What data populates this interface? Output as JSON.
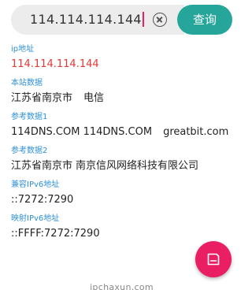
{
  "search": {
    "value": "114.114.114.144",
    "button_label": "查询"
  },
  "results": [
    {
      "label": "ip地址",
      "value": "114.114.114.144",
      "highlight": true
    },
    {
      "label": "本站数据",
      "parts": [
        "江苏省南京市",
        "电信"
      ]
    },
    {
      "label": "参考数据1",
      "parts": [
        "114DNS.COM 114DNS.COM",
        "greatbit.com"
      ]
    },
    {
      "label": "参考数据2",
      "parts": [
        "江苏省南京市",
        "南京信风网络科技有限公司"
      ]
    },
    {
      "label": "兼容IPv6地址",
      "value": "::7272:7290"
    },
    {
      "label": "映射IPv6地址",
      "value": "::FFFF:7272:7290"
    }
  ],
  "fab": {
    "icon": "save-icon"
  },
  "footer": {
    "text": "ipchaxun.com"
  },
  "colors": {
    "accent": "#26a69a",
    "fab": "#e91e63",
    "label": "#2d8fd6",
    "highlight": "#e53935"
  }
}
